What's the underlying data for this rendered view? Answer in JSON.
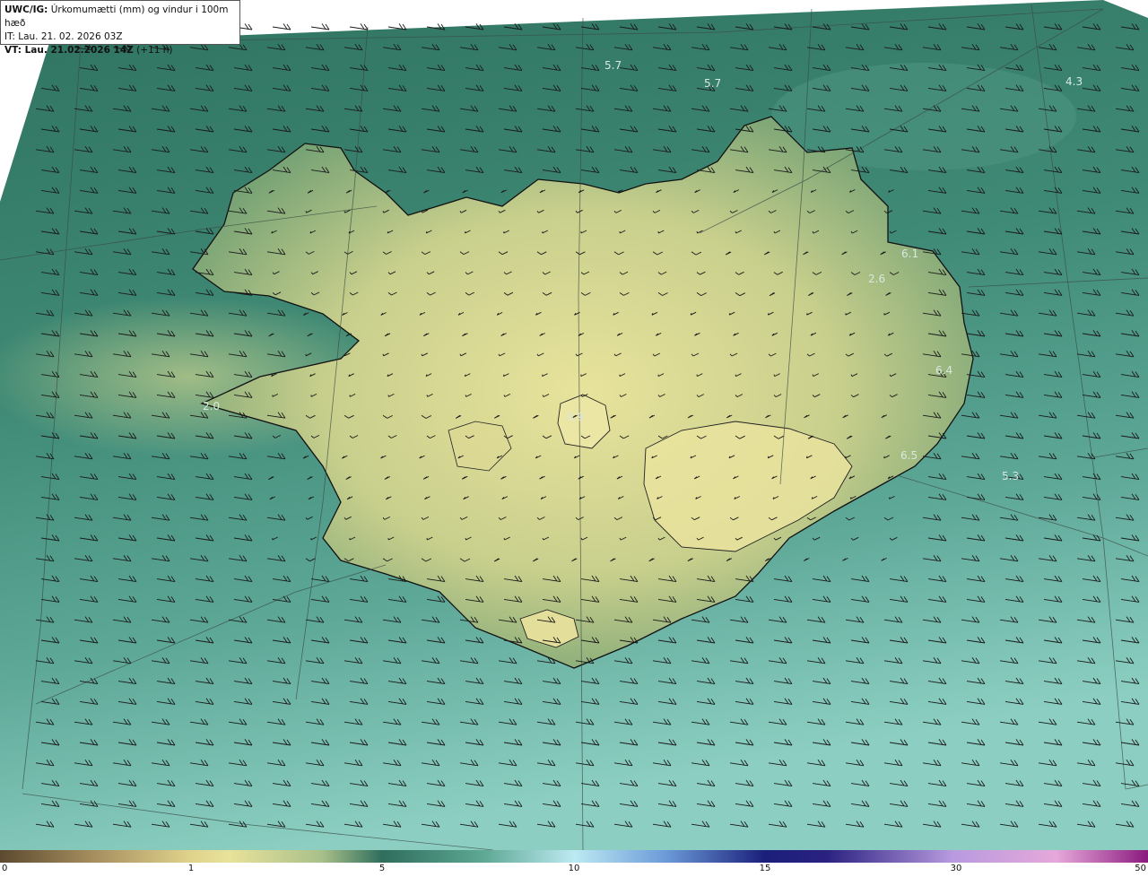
{
  "header": {
    "model": "UWC/IG:",
    "variable": "Úrkomumætti (mm) og vindur i 100m hæð",
    "init_time": "IT: Lau. 21. 02. 2026 03Z",
    "valid_prefix": "VT: Lau. 21.02.2026 14Z",
    "lead": "(+11 h)"
  },
  "colorbar": {
    "ticks": [
      "0",
      "1",
      "5",
      "10",
      "15",
      "30",
      "50"
    ]
  },
  "map_labels": [
    {
      "id": "n1",
      "text": "5.7"
    },
    {
      "id": "n2",
      "text": "5.7"
    },
    {
      "id": "ne1",
      "text": "4.3"
    },
    {
      "id": "e1",
      "text": "6.1"
    },
    {
      "id": "e2",
      "text": "2.6"
    },
    {
      "id": "e3",
      "text": "6.4"
    },
    {
      "id": "e4",
      "text": "6.5"
    },
    {
      "id": "se1",
      "text": "5.3"
    },
    {
      "id": "c1",
      "text": "0.9"
    },
    {
      "id": "w1",
      "text": "2.0"
    }
  ],
  "colors": {
    "ocean_dark": "#2f6e5c",
    "ocean_light": "#7fc2b4",
    "land_low": "#93b77e",
    "land_high": "#e6e39a",
    "coastline": "#111111"
  }
}
